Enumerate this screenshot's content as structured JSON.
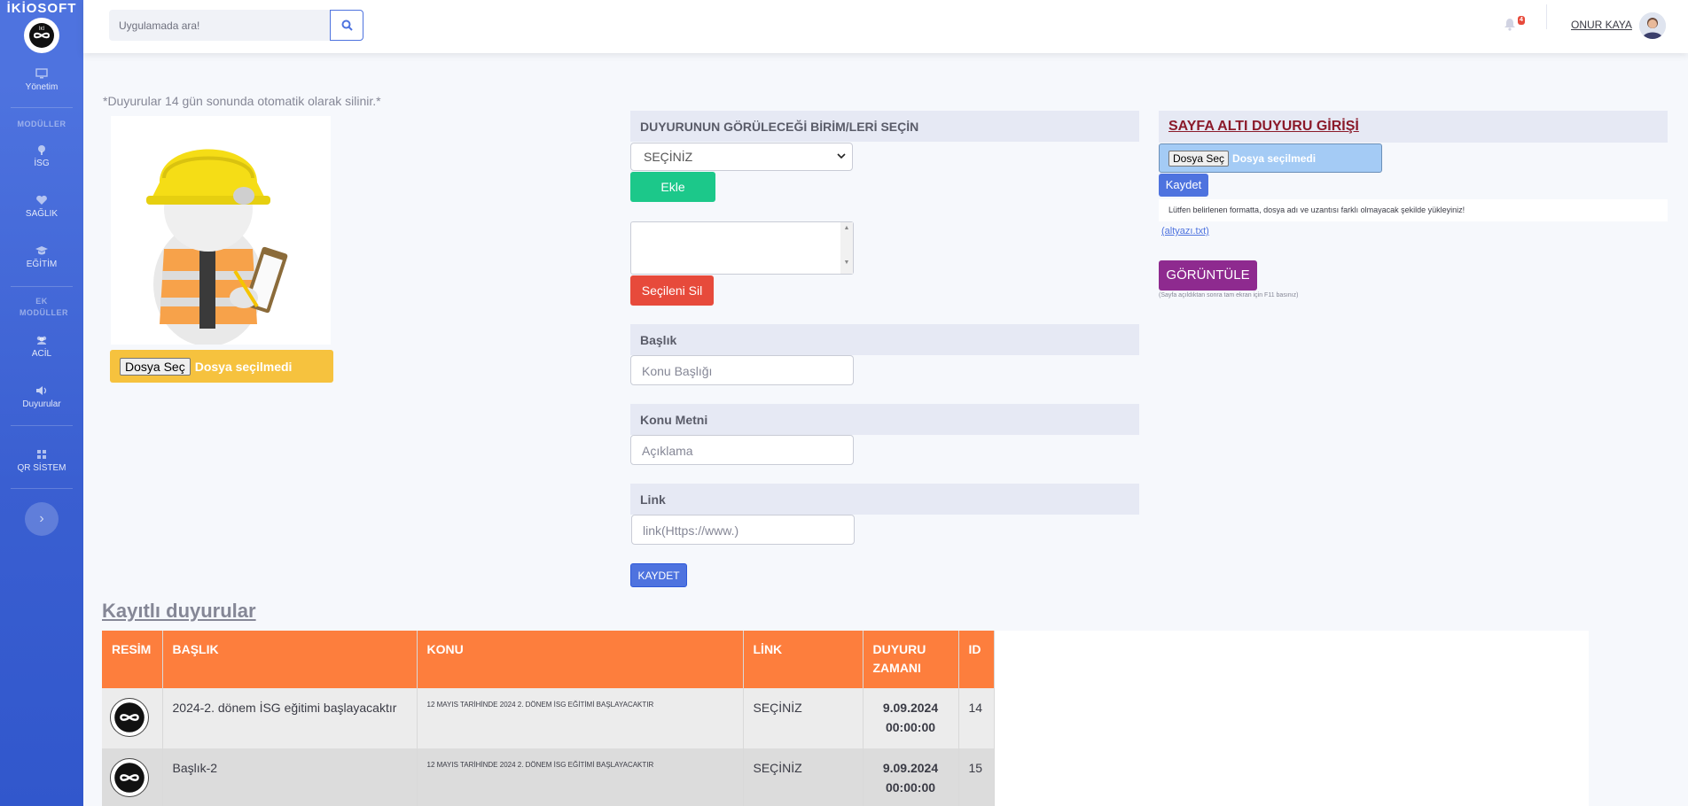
{
  "app": {
    "brand": "İKİOSOFT"
  },
  "sidebar": {
    "items": [
      {
        "label": "Yönetim",
        "icon": "monitor-icon"
      },
      {
        "label": "İSG",
        "icon": "pin-icon"
      },
      {
        "label": "SAĞLIK",
        "icon": "heart-icon"
      },
      {
        "label": "EĞİTİM",
        "icon": "graduation-cap-icon"
      },
      {
        "label": "ACİL",
        "icon": "users-icon"
      },
      {
        "label": "Duyurular",
        "icon": "volume-icon"
      },
      {
        "label": "QR SİSTEM",
        "icon": "grid-icon"
      }
    ],
    "headings": [
      "MODÜLLER",
      "EK MODÜLLER"
    ]
  },
  "topbar": {
    "search_placeholder": "Uygulamada ara!",
    "notification_count": "4",
    "user_name": "ONUR KAYA"
  },
  "notice": "*Duyurular 14 gün sonunda otomatik olarak silinir.*",
  "image_upload": {
    "button": "Dosya Seç",
    "status": "Dosya seçilmedi"
  },
  "form": {
    "unit_heading": "DUYURUNUN GÖRÜLECEĞİ BİRİM/LERİ SEÇİN",
    "select_value": "SEÇİNİZ",
    "add_button": "Ekle",
    "delete_button": "Seçileni Sil",
    "title_heading": "Başlık",
    "title_placeholder": "Konu Başlığı",
    "text_heading": "Konu Metni",
    "text_placeholder": "Açıklama",
    "link_heading": "Link",
    "link_placeholder": "link(Https://www.)",
    "save_button": "KAYDET"
  },
  "footer_notice": {
    "heading": "SAYFA ALTI DUYURU GİRİŞİ",
    "file_button": "Dosya Seç",
    "file_status": "Dosya seçilmedi",
    "save_button": "Kaydet",
    "info": "Lütfen belirlenen formatta, dosya adı ve uzantısı farklı olmayacak şekilde yükleyiniz!",
    "link": "(altyazı.txt)",
    "view_button": "GÖRÜNTÜLE",
    "note": "(Sayfa açıldıktan sonra tam ekran için F11 basınız)"
  },
  "table": {
    "title": "Kayıtlı duyurular",
    "headers": [
      "RESİM",
      "BAŞLIK",
      "KONU",
      "LİNK",
      "DUYURU ZAMANI",
      "ID"
    ],
    "rows": [
      {
        "baslik": "2024-2. dönem İSG eğitimi başlayacaktır",
        "konu": "12 MAYIS TARİHİNDE 2024 2. DÖNEM İSG EĞİTİMİ BAŞLAYACAKTIR",
        "link": "SEÇİNİZ",
        "date": "9.09.2024",
        "time": "00:00:00",
        "id": "14"
      },
      {
        "baslik": "Başlık-2",
        "konu": "12 MAYIS TARİHİNDE 2024 2. DÖNEM İSG EĞİTİMİ BAŞLAYACAKTIR",
        "link": "SEÇİNİZ",
        "date": "9.09.2024",
        "time": "00:00:00",
        "id": "15"
      }
    ]
  }
}
